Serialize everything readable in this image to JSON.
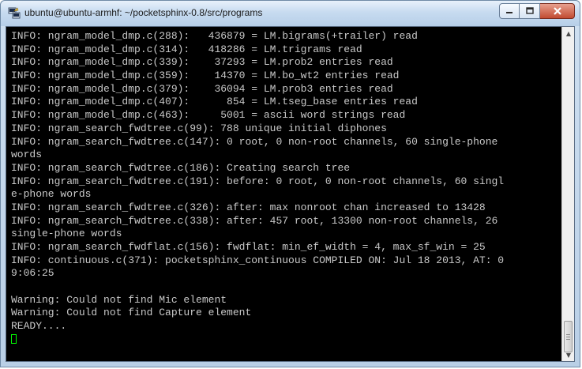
{
  "window": {
    "title": "ubuntu@ubuntu-armhf: ~/pocketsphinx-0.8/src/programs",
    "controls": {
      "minimize_icon": "minimize-icon",
      "maximize_icon": "maximize-icon",
      "close_icon": "close-icon"
    }
  },
  "terminal": {
    "lines": [
      "INFO: ngram_model_dmp.c(288):   436879 = LM.bigrams(+trailer) read",
      "INFO: ngram_model_dmp.c(314):   418286 = LM.trigrams read",
      "INFO: ngram_model_dmp.c(339):    37293 = LM.prob2 entries read",
      "INFO: ngram_model_dmp.c(359):    14370 = LM.bo_wt2 entries read",
      "INFO: ngram_model_dmp.c(379):    36094 = LM.prob3 entries read",
      "INFO: ngram_model_dmp.c(407):      854 = LM.tseg_base entries read",
      "INFO: ngram_model_dmp.c(463):     5001 = ascii word strings read",
      "INFO: ngram_search_fwdtree.c(99): 788 unique initial diphones",
      "INFO: ngram_search_fwdtree.c(147): 0 root, 0 non-root channels, 60 single-phone",
      "words",
      "INFO: ngram_search_fwdtree.c(186): Creating search tree",
      "INFO: ngram_search_fwdtree.c(191): before: 0 root, 0 non-root channels, 60 singl",
      "e-phone words",
      "INFO: ngram_search_fwdtree.c(326): after: max nonroot chan increased to 13428",
      "INFO: ngram_search_fwdtree.c(338): after: 457 root, 13300 non-root channels, 26",
      "single-phone words",
      "INFO: ngram_search_fwdflat.c(156): fwdflat: min_ef_width = 4, max_sf_win = 25",
      "INFO: continuous.c(371): pocketsphinx_continuous COMPILED ON: Jul 18 2013, AT: 0",
      "9:06:25",
      "",
      "Warning: Could not find Mic element",
      "Warning: Could not find Capture element",
      "READY...."
    ]
  },
  "colors": {
    "terminal_bg": "#000000",
    "terminal_fg": "#c9c9c9",
    "cursor": "#00ff00"
  }
}
